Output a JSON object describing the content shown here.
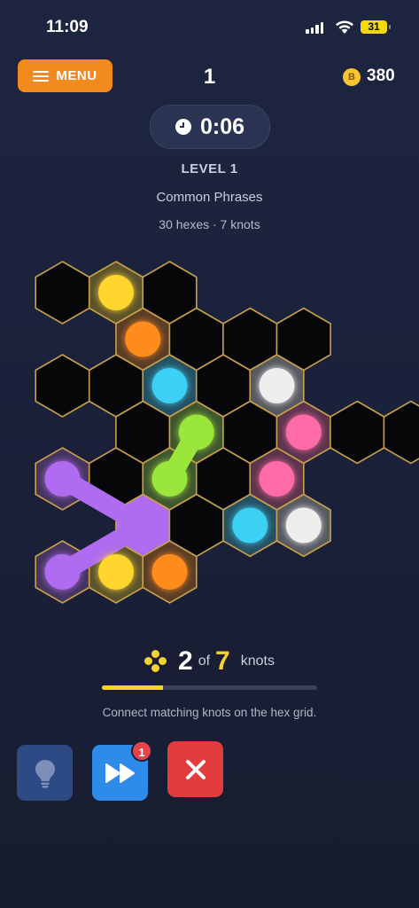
{
  "status_bar": {
    "time": "11:09",
    "battery": "31"
  },
  "header": {
    "menu_label": "MENU",
    "level_number": "1",
    "coin_symbol": "B",
    "coins": "380"
  },
  "timer": {
    "value": "0:06"
  },
  "level": {
    "title": "LEVEL 1",
    "category": "Common Phrases",
    "info": "30 hexes · 7 knots"
  },
  "board": {
    "cells": [
      {
        "c": 0,
        "r": 0,
        "knot": null
      },
      {
        "c": 1,
        "r": 0,
        "knot": "yellow"
      },
      {
        "c": 2,
        "r": 0,
        "knot": null
      },
      {
        "c": 1,
        "r": 1,
        "knot": "orange"
      },
      {
        "c": 2,
        "r": 1,
        "knot": null
      },
      {
        "c": 3,
        "r": 1,
        "knot": null
      },
      {
        "c": 4,
        "r": 1,
        "knot": null
      },
      {
        "c": 0,
        "r": 2,
        "knot": null
      },
      {
        "c": 1,
        "r": 2,
        "knot": null
      },
      {
        "c": 2,
        "r": 2,
        "knot": "cyan"
      },
      {
        "c": 3,
        "r": 2,
        "knot": null
      },
      {
        "c": 4,
        "r": 2,
        "knot": "white"
      },
      {
        "c": 1,
        "r": 3,
        "knot": null
      },
      {
        "c": 2,
        "r": 3,
        "knot": "green"
      },
      {
        "c": 3,
        "r": 3,
        "knot": null
      },
      {
        "c": 4,
        "r": 3,
        "knot": "pink"
      },
      {
        "c": 5,
        "r": 3,
        "knot": null
      },
      {
        "c": 6,
        "r": 3,
        "knot": null
      },
      {
        "c": 0,
        "r": 4,
        "knot": "purple"
      },
      {
        "c": 1,
        "r": 4,
        "knot": null
      },
      {
        "c": 2,
        "r": 4,
        "knot": "green"
      },
      {
        "c": 3,
        "r": 4,
        "knot": null
      },
      {
        "c": 4,
        "r": 4,
        "knot": "pink"
      },
      {
        "c": 1,
        "r": 5,
        "knot": null,
        "path": "purple"
      },
      {
        "c": 2,
        "r": 5,
        "knot": null
      },
      {
        "c": 3,
        "r": 5,
        "knot": "cyan"
      },
      {
        "c": 4,
        "r": 5,
        "knot": "white"
      },
      {
        "c": 0,
        "r": 6,
        "knot": "purple"
      },
      {
        "c": 1,
        "r": 6,
        "knot": "yellow"
      },
      {
        "c": 2,
        "r": 6,
        "knot": "orange"
      }
    ],
    "connections": [
      {
        "color": "green",
        "from": [
          2,
          3
        ],
        "to": [
          2,
          4
        ]
      },
      {
        "color": "purple",
        "from": [
          0,
          4
        ],
        "to": [
          1,
          5
        ]
      },
      {
        "color": "purple",
        "from": [
          1,
          5
        ],
        "to": [
          0,
          6
        ]
      }
    ],
    "colors": {
      "yellow": "#ffd52e",
      "orange": "#ff8c1f",
      "cyan": "#3ed0f5",
      "white": "#eeeeee",
      "pink": "#ff6aa8",
      "green": "#9be63a",
      "purple": "#b06cf0"
    }
  },
  "progress": {
    "current": "2",
    "of": "of",
    "total": "7",
    "label": "knots",
    "fraction": 0.286
  },
  "hint_text": "Connect matching knots on the hex grid.",
  "actions": {
    "skip_badge": "1"
  }
}
